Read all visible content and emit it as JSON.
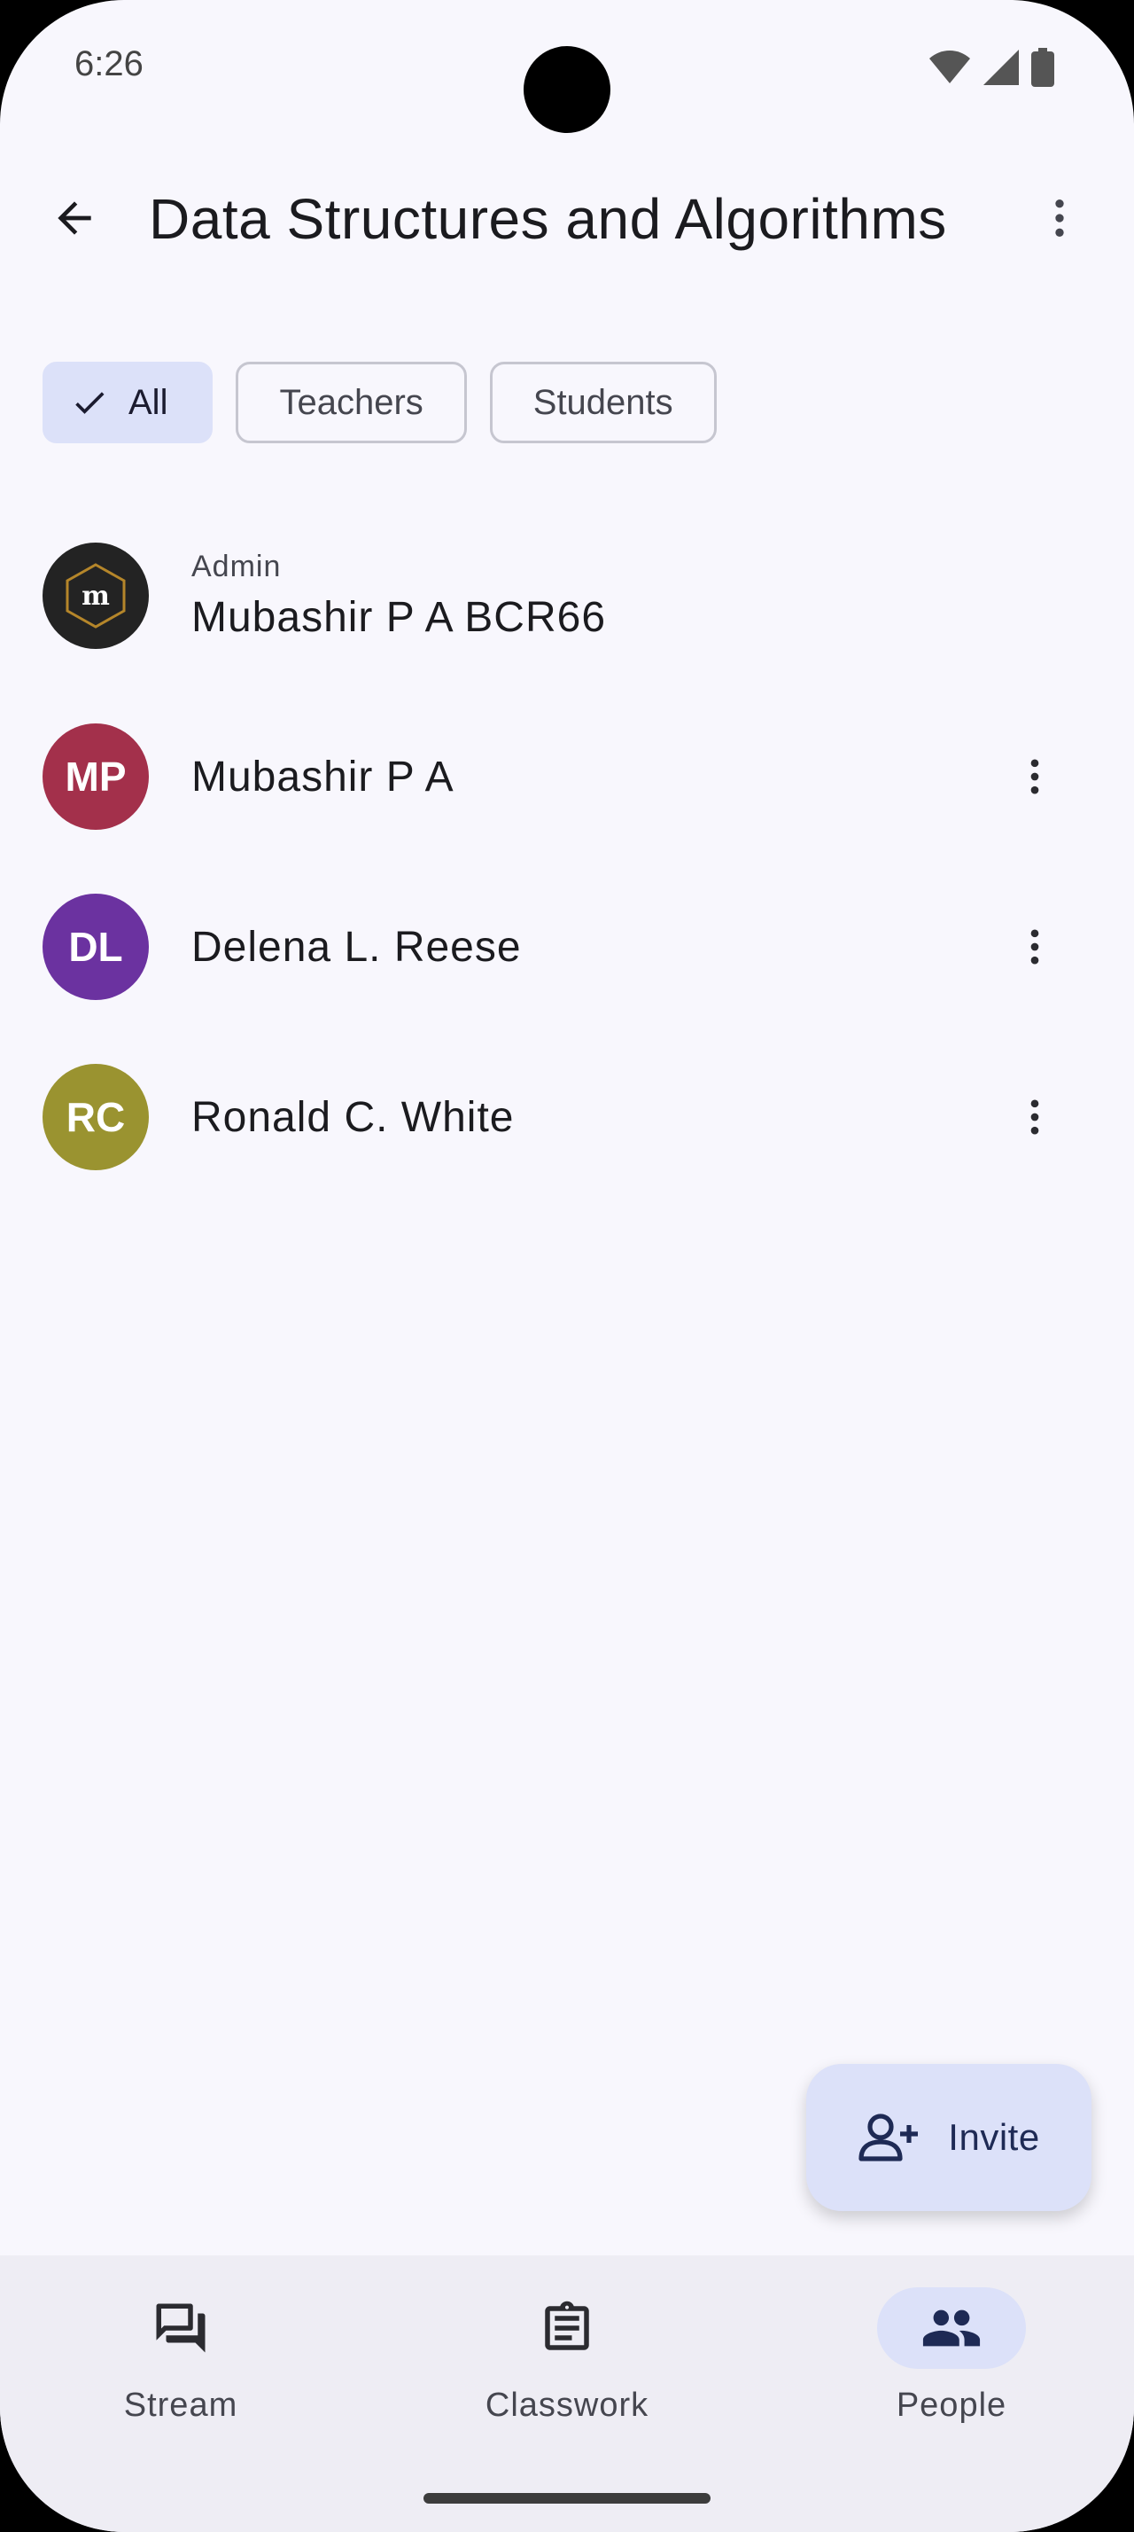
{
  "status_bar": {
    "time": "6:26"
  },
  "header": {
    "title": "Data Structures and Algorithms"
  },
  "filters": [
    {
      "label": "All",
      "selected": true
    },
    {
      "label": "Teachers",
      "selected": false
    },
    {
      "label": "Students",
      "selected": false
    }
  ],
  "people": [
    {
      "role": "Admin",
      "name": "Mubashir P A BCR66",
      "avatar_logo": "m",
      "avatar_color": "#232323"
    },
    {
      "name": "Mubashir P A",
      "initials": "MP",
      "avatar_color": "#a3304b"
    },
    {
      "name": "Delena L. Reese",
      "initials": "DL",
      "avatar_color": "#6b32a0"
    },
    {
      "name": "Ronald C. White",
      "initials": "RC",
      "avatar_color": "#9a9330"
    }
  ],
  "fab": {
    "label": "Invite"
  },
  "bottom_nav": [
    {
      "label": "Stream",
      "icon": "forum-icon"
    },
    {
      "label": "Classwork",
      "icon": "assignment-icon"
    },
    {
      "label": "People",
      "icon": "people-icon",
      "active": true
    }
  ],
  "colors": {
    "accent_container": "#dce1f9",
    "background": "#f8f7fd"
  }
}
